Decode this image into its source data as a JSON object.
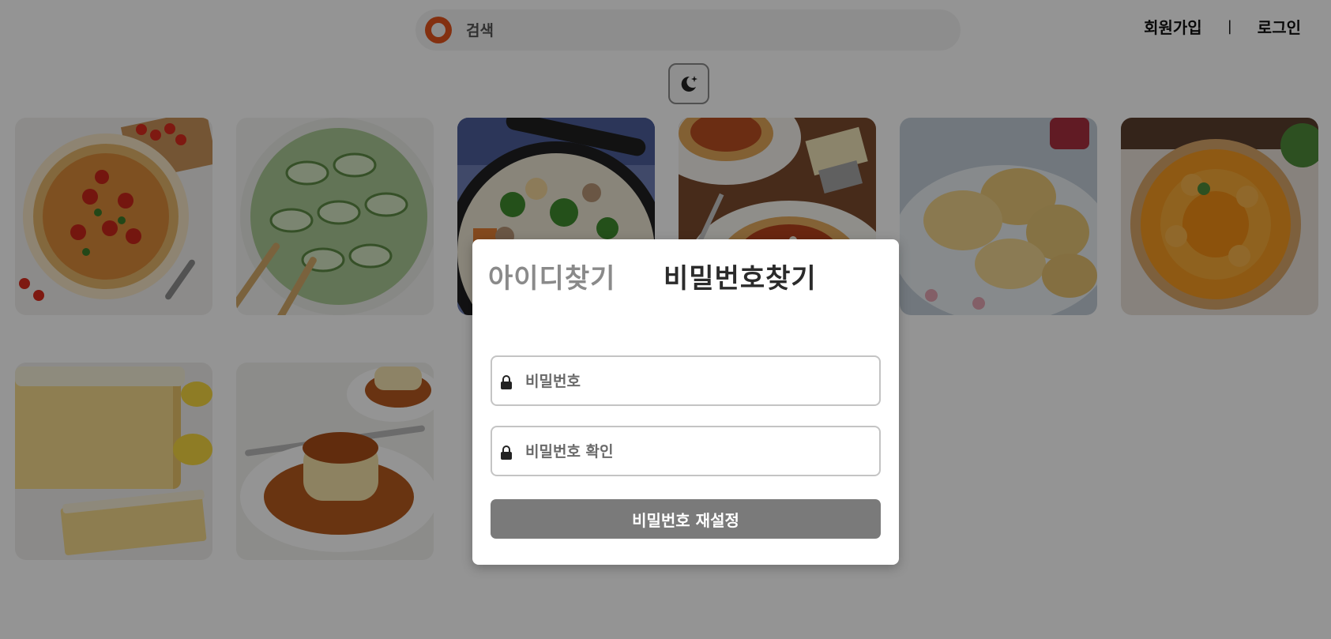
{
  "search": {
    "placeholder": "검색",
    "logo": "search-logo-icon"
  },
  "auth": {
    "signup": "회원가입",
    "separator": "|",
    "login": "로그인"
  },
  "theme_toggle": {
    "icon": "moon-star-icon"
  },
  "food_cards": [
    {
      "name": "pizza"
    },
    {
      "name": "cucumber-salad"
    },
    {
      "name": "cream-stew"
    },
    {
      "name": "spaghetti"
    },
    {
      "name": "scones"
    },
    {
      "name": "orange-tart"
    },
    {
      "name": "lemon-pound-cake"
    },
    {
      "name": "caramel-pudding"
    }
  ],
  "modal": {
    "tab_find_id": "아이디찾기",
    "tab_find_password": "비밀번호찾기",
    "active_tab": "tab_find_password",
    "password_placeholder": "비밀번호",
    "password_confirm_placeholder": "비밀번호 확인",
    "submit_label": "비밀번호 재설정"
  },
  "colors": {
    "brand": "#e2531c",
    "overlay": "rgba(0,0,0,0.42)",
    "button": "#7a7a7a",
    "inactive_tab": "#8a8a8a"
  }
}
